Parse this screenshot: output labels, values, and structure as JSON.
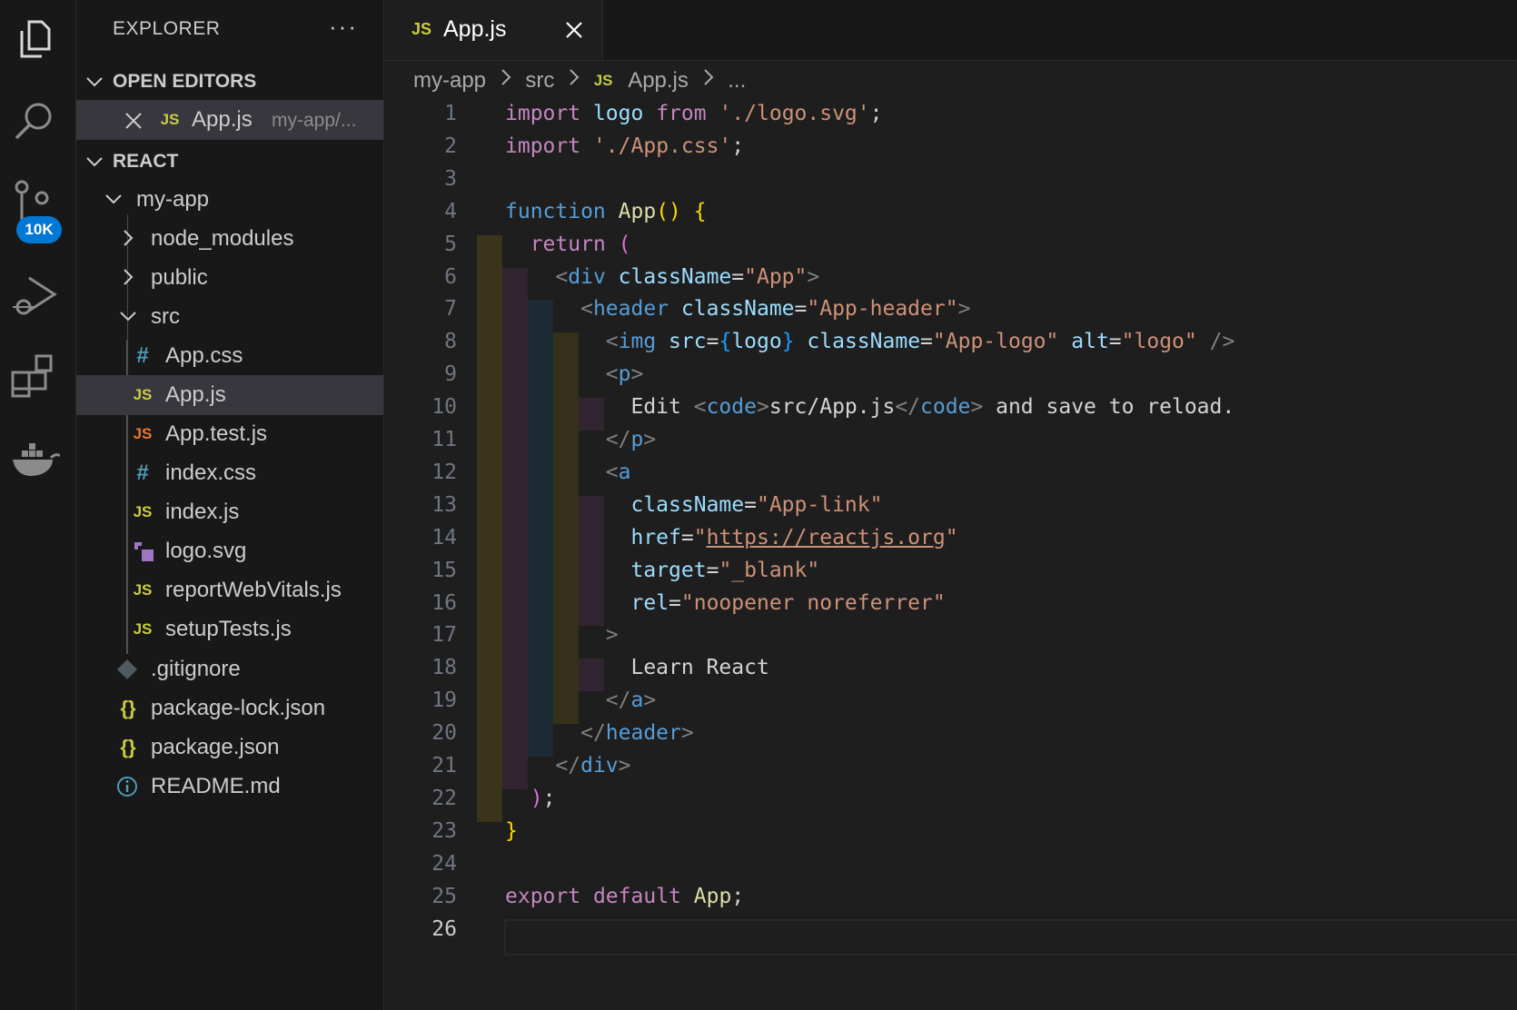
{
  "activity_bar": {
    "items": [
      {
        "name": "explorer-icon"
      },
      {
        "name": "search-icon"
      },
      {
        "name": "source-control-icon"
      },
      {
        "name": "run-debug-icon"
      },
      {
        "name": "extensions-icon"
      },
      {
        "name": "docker-icon"
      }
    ],
    "source_control_badge": "10K"
  },
  "sidebar": {
    "title": "EXPLORER",
    "more": "···",
    "open_editors_header": "OPEN EDITORS",
    "open_editor": {
      "icon": "JS",
      "name": "App.js",
      "path": "my-app/..."
    },
    "workspace_header": "REACT",
    "tree": [
      {
        "label": "my-app",
        "kind": "folder-open"
      },
      {
        "label": "node_modules",
        "kind": "folder-closed"
      },
      {
        "label": "public",
        "kind": "folder-closed"
      },
      {
        "label": "src",
        "kind": "folder-open"
      },
      {
        "label": "App.css",
        "icon": "#"
      },
      {
        "label": "App.js",
        "icon": "JS"
      },
      {
        "label": "App.test.js",
        "icon": "JS"
      },
      {
        "label": "index.css",
        "icon": "#"
      },
      {
        "label": "index.js",
        "icon": "JS"
      },
      {
        "label": "logo.svg",
        "icon": "svg"
      },
      {
        "label": "reportWebVitals.js",
        "icon": "JS"
      },
      {
        "label": "setupTests.js",
        "icon": "JS"
      },
      {
        "label": ".gitignore",
        "icon": "git"
      },
      {
        "label": "package-lock.json",
        "icon": "{}"
      },
      {
        "label": "package.json",
        "icon": "{}"
      },
      {
        "label": "README.md",
        "icon": "info"
      }
    ],
    "selected": "App.js"
  },
  "tab": {
    "icon": "JS",
    "name": "App.js"
  },
  "breadcrumb": [
    "my-app",
    "src",
    "App.js",
    "..."
  ],
  "breadcrumb_file_icon": "JS",
  "editor": {
    "line_numbers": [
      "1",
      "2",
      "3",
      "4",
      "5",
      "6",
      "7",
      "8",
      "9",
      "10",
      "11",
      "12",
      "13",
      "14",
      "15",
      "16",
      "17",
      "18",
      "19",
      "20",
      "21",
      "22",
      "23",
      "24",
      "25",
      "26"
    ],
    "active_line": "26",
    "lines": [
      [
        [
          "kw",
          "import"
        ],
        [
          "tx",
          " "
        ],
        [
          "vr",
          "logo"
        ],
        [
          "tx",
          " "
        ],
        [
          "kw",
          "from"
        ],
        [
          "tx",
          " "
        ],
        [
          "st",
          "'./logo.svg'"
        ],
        [
          "tx",
          ";"
        ]
      ],
      [
        [
          "kw",
          "import"
        ],
        [
          "tx",
          " "
        ],
        [
          "st",
          "'./App.css'"
        ],
        [
          "tx",
          ";"
        ]
      ],
      [],
      [
        [
          "kb",
          "function"
        ],
        [
          "tx",
          " "
        ],
        [
          "fn",
          "App"
        ],
        [
          "br1",
          "()"
        ],
        [
          "tx",
          " "
        ],
        [
          "br1",
          "{"
        ]
      ],
      [
        [
          "tx",
          "  "
        ],
        [
          "kw",
          "return"
        ],
        [
          "tx",
          " "
        ],
        [
          "br2",
          "("
        ]
      ],
      [
        [
          "tx",
          "    "
        ],
        [
          "pt",
          "<"
        ],
        [
          "tg",
          "div"
        ],
        [
          "tx",
          " "
        ],
        [
          "at",
          "className"
        ],
        [
          "tx",
          "="
        ],
        [
          "st",
          "\"App\""
        ],
        [
          "pt",
          ">"
        ]
      ],
      [
        [
          "tx",
          "      "
        ],
        [
          "pt",
          "<"
        ],
        [
          "tg",
          "header"
        ],
        [
          "tx",
          " "
        ],
        [
          "at",
          "className"
        ],
        [
          "tx",
          "="
        ],
        [
          "st",
          "\"App-header\""
        ],
        [
          "pt",
          ">"
        ]
      ],
      [
        [
          "tx",
          "        "
        ],
        [
          "pt",
          "<"
        ],
        [
          "tg",
          "img"
        ],
        [
          "tx",
          " "
        ],
        [
          "at",
          "src"
        ],
        [
          "tx",
          "="
        ],
        [
          "br3",
          "{"
        ],
        [
          "vr",
          "logo"
        ],
        [
          "br3",
          "}"
        ],
        [
          "tx",
          " "
        ],
        [
          "at",
          "className"
        ],
        [
          "tx",
          "="
        ],
        [
          "st",
          "\"App-logo\""
        ],
        [
          "tx",
          " "
        ],
        [
          "at",
          "alt"
        ],
        [
          "tx",
          "="
        ],
        [
          "st",
          "\"logo\""
        ],
        [
          "tx",
          " "
        ],
        [
          "pt",
          "/>"
        ]
      ],
      [
        [
          "tx",
          "        "
        ],
        [
          "pt",
          "<"
        ],
        [
          "tg",
          "p"
        ],
        [
          "pt",
          ">"
        ]
      ],
      [
        [
          "tx",
          "          Edit "
        ],
        [
          "pt",
          "<"
        ],
        [
          "tg",
          "code"
        ],
        [
          "pt",
          ">"
        ],
        [
          "tx",
          "src/App.js"
        ],
        [
          "pt",
          "</"
        ],
        [
          "tg",
          "code"
        ],
        [
          "pt",
          ">"
        ],
        [
          "tx",
          " and save to reload."
        ]
      ],
      [
        [
          "tx",
          "        "
        ],
        [
          "pt",
          "</"
        ],
        [
          "tg",
          "p"
        ],
        [
          "pt",
          ">"
        ]
      ],
      [
        [
          "tx",
          "        "
        ],
        [
          "pt",
          "<"
        ],
        [
          "tg",
          "a"
        ]
      ],
      [
        [
          "tx",
          "          "
        ],
        [
          "at",
          "className"
        ],
        [
          "tx",
          "="
        ],
        [
          "st",
          "\"App-link\""
        ]
      ],
      [
        [
          "tx",
          "          "
        ],
        [
          "at",
          "href"
        ],
        [
          "tx",
          "="
        ],
        [
          "st",
          "\""
        ],
        [
          "st ul",
          "https://reactjs.org"
        ],
        [
          "st",
          "\""
        ]
      ],
      [
        [
          "tx",
          "          "
        ],
        [
          "at",
          "target"
        ],
        [
          "tx",
          "="
        ],
        [
          "st",
          "\"_blank\""
        ]
      ],
      [
        [
          "tx",
          "          "
        ],
        [
          "at",
          "rel"
        ],
        [
          "tx",
          "="
        ],
        [
          "st",
          "\"noopener noreferrer\""
        ]
      ],
      [
        [
          "tx",
          "        "
        ],
        [
          "pt",
          ">"
        ]
      ],
      [
        [
          "tx",
          "          Learn React"
        ]
      ],
      [
        [
          "tx",
          "        "
        ],
        [
          "pt",
          "</"
        ],
        [
          "tg",
          "a"
        ],
        [
          "pt",
          ">"
        ]
      ],
      [
        [
          "tx",
          "      "
        ],
        [
          "pt",
          "</"
        ],
        [
          "tg",
          "header"
        ],
        [
          "pt",
          ">"
        ]
      ],
      [
        [
          "tx",
          "    "
        ],
        [
          "pt",
          "</"
        ],
        [
          "tg",
          "div"
        ],
        [
          "pt",
          ">"
        ]
      ],
      [
        [
          "tx",
          "  "
        ],
        [
          "br2",
          ")"
        ],
        [
          "tx",
          ";"
        ]
      ],
      [
        [
          "br1",
          "}"
        ]
      ],
      [],
      [
        [
          "kw",
          "export"
        ],
        [
          "tx",
          " "
        ],
        [
          "kw",
          "default"
        ],
        [
          "tx",
          " "
        ],
        [
          "fn",
          "App"
        ],
        [
          "tx",
          ";"
        ]
      ],
      []
    ]
  },
  "colors": {
    "background": "#1e1e1e",
    "sidebar": "#181818",
    "selection": "#37373d",
    "accent_badge": "#0078d4",
    "js_icon": "#cbcb41"
  }
}
